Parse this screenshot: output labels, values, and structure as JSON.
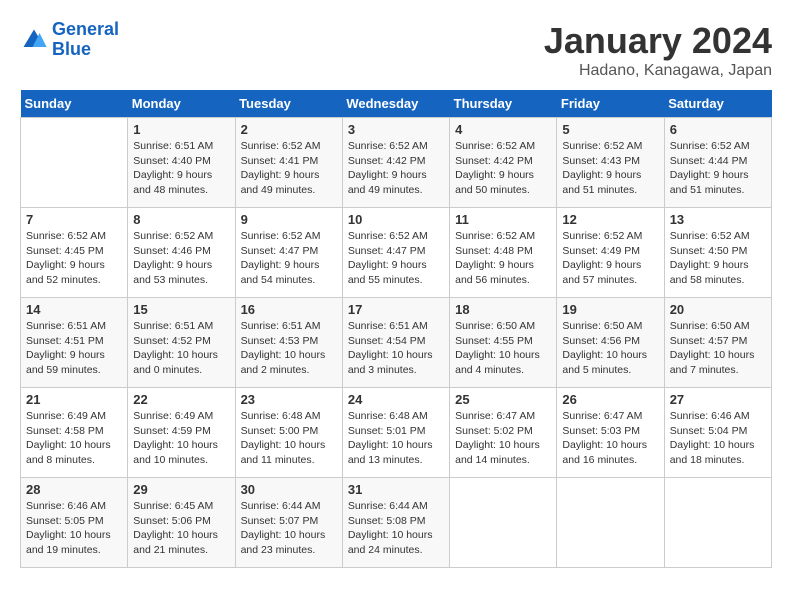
{
  "header": {
    "logo_line1": "General",
    "logo_line2": "Blue",
    "month_title": "January 2024",
    "subtitle": "Hadano, Kanagawa, Japan"
  },
  "weekdays": [
    "Sunday",
    "Monday",
    "Tuesday",
    "Wednesday",
    "Thursday",
    "Friday",
    "Saturday"
  ],
  "weeks": [
    [
      {
        "day": "",
        "info": ""
      },
      {
        "day": "1",
        "info": "Sunrise: 6:51 AM\nSunset: 4:40 PM\nDaylight: 9 hours\nand 48 minutes."
      },
      {
        "day": "2",
        "info": "Sunrise: 6:52 AM\nSunset: 4:41 PM\nDaylight: 9 hours\nand 49 minutes."
      },
      {
        "day": "3",
        "info": "Sunrise: 6:52 AM\nSunset: 4:42 PM\nDaylight: 9 hours\nand 49 minutes."
      },
      {
        "day": "4",
        "info": "Sunrise: 6:52 AM\nSunset: 4:42 PM\nDaylight: 9 hours\nand 50 minutes."
      },
      {
        "day": "5",
        "info": "Sunrise: 6:52 AM\nSunset: 4:43 PM\nDaylight: 9 hours\nand 51 minutes."
      },
      {
        "day": "6",
        "info": "Sunrise: 6:52 AM\nSunset: 4:44 PM\nDaylight: 9 hours\nand 51 minutes."
      }
    ],
    [
      {
        "day": "7",
        "info": "Sunrise: 6:52 AM\nSunset: 4:45 PM\nDaylight: 9 hours\nand 52 minutes."
      },
      {
        "day": "8",
        "info": "Sunrise: 6:52 AM\nSunset: 4:46 PM\nDaylight: 9 hours\nand 53 minutes."
      },
      {
        "day": "9",
        "info": "Sunrise: 6:52 AM\nSunset: 4:47 PM\nDaylight: 9 hours\nand 54 minutes."
      },
      {
        "day": "10",
        "info": "Sunrise: 6:52 AM\nSunset: 4:47 PM\nDaylight: 9 hours\nand 55 minutes."
      },
      {
        "day": "11",
        "info": "Sunrise: 6:52 AM\nSunset: 4:48 PM\nDaylight: 9 hours\nand 56 minutes."
      },
      {
        "day": "12",
        "info": "Sunrise: 6:52 AM\nSunset: 4:49 PM\nDaylight: 9 hours\nand 57 minutes."
      },
      {
        "day": "13",
        "info": "Sunrise: 6:52 AM\nSunset: 4:50 PM\nDaylight: 9 hours\nand 58 minutes."
      }
    ],
    [
      {
        "day": "14",
        "info": "Sunrise: 6:51 AM\nSunset: 4:51 PM\nDaylight: 9 hours\nand 59 minutes."
      },
      {
        "day": "15",
        "info": "Sunrise: 6:51 AM\nSunset: 4:52 PM\nDaylight: 10 hours\nand 0 minutes."
      },
      {
        "day": "16",
        "info": "Sunrise: 6:51 AM\nSunset: 4:53 PM\nDaylight: 10 hours\nand 2 minutes."
      },
      {
        "day": "17",
        "info": "Sunrise: 6:51 AM\nSunset: 4:54 PM\nDaylight: 10 hours\nand 3 minutes."
      },
      {
        "day": "18",
        "info": "Sunrise: 6:50 AM\nSunset: 4:55 PM\nDaylight: 10 hours\nand 4 minutes."
      },
      {
        "day": "19",
        "info": "Sunrise: 6:50 AM\nSunset: 4:56 PM\nDaylight: 10 hours\nand 5 minutes."
      },
      {
        "day": "20",
        "info": "Sunrise: 6:50 AM\nSunset: 4:57 PM\nDaylight: 10 hours\nand 7 minutes."
      }
    ],
    [
      {
        "day": "21",
        "info": "Sunrise: 6:49 AM\nSunset: 4:58 PM\nDaylight: 10 hours\nand 8 minutes."
      },
      {
        "day": "22",
        "info": "Sunrise: 6:49 AM\nSunset: 4:59 PM\nDaylight: 10 hours\nand 10 minutes."
      },
      {
        "day": "23",
        "info": "Sunrise: 6:48 AM\nSunset: 5:00 PM\nDaylight: 10 hours\nand 11 minutes."
      },
      {
        "day": "24",
        "info": "Sunrise: 6:48 AM\nSunset: 5:01 PM\nDaylight: 10 hours\nand 13 minutes."
      },
      {
        "day": "25",
        "info": "Sunrise: 6:47 AM\nSunset: 5:02 PM\nDaylight: 10 hours\nand 14 minutes."
      },
      {
        "day": "26",
        "info": "Sunrise: 6:47 AM\nSunset: 5:03 PM\nDaylight: 10 hours\nand 16 minutes."
      },
      {
        "day": "27",
        "info": "Sunrise: 6:46 AM\nSunset: 5:04 PM\nDaylight: 10 hours\nand 18 minutes."
      }
    ],
    [
      {
        "day": "28",
        "info": "Sunrise: 6:46 AM\nSunset: 5:05 PM\nDaylight: 10 hours\nand 19 minutes."
      },
      {
        "day": "29",
        "info": "Sunrise: 6:45 AM\nSunset: 5:06 PM\nDaylight: 10 hours\nand 21 minutes."
      },
      {
        "day": "30",
        "info": "Sunrise: 6:44 AM\nSunset: 5:07 PM\nDaylight: 10 hours\nand 23 minutes."
      },
      {
        "day": "31",
        "info": "Sunrise: 6:44 AM\nSunset: 5:08 PM\nDaylight: 10 hours\nand 24 minutes."
      },
      {
        "day": "",
        "info": ""
      },
      {
        "day": "",
        "info": ""
      },
      {
        "day": "",
        "info": ""
      }
    ]
  ]
}
